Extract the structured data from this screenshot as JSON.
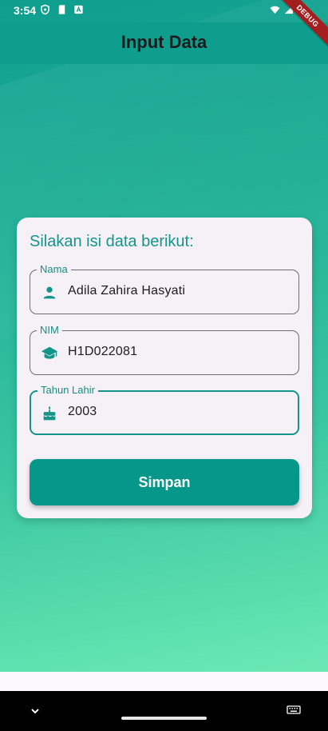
{
  "status_bar": {
    "time": "3:54"
  },
  "debug_banner": "DEBUG",
  "app_bar": {
    "title": "Input Data"
  },
  "form": {
    "heading": "Silakan isi data berikut:",
    "fields": [
      {
        "label": "Nama",
        "value": "Adila Zahira Hasyati",
        "icon": "person-icon"
      },
      {
        "label": "NIM",
        "value": "H1D022081",
        "icon": "school-icon"
      },
      {
        "label": "Tahun Lahir",
        "value": "2003",
        "icon": "cake-icon"
      }
    ],
    "submit_label": "Simpan"
  },
  "colors": {
    "primary": "#05978a",
    "accent_text": "#14958a",
    "card_background": "#f5f1f7"
  }
}
